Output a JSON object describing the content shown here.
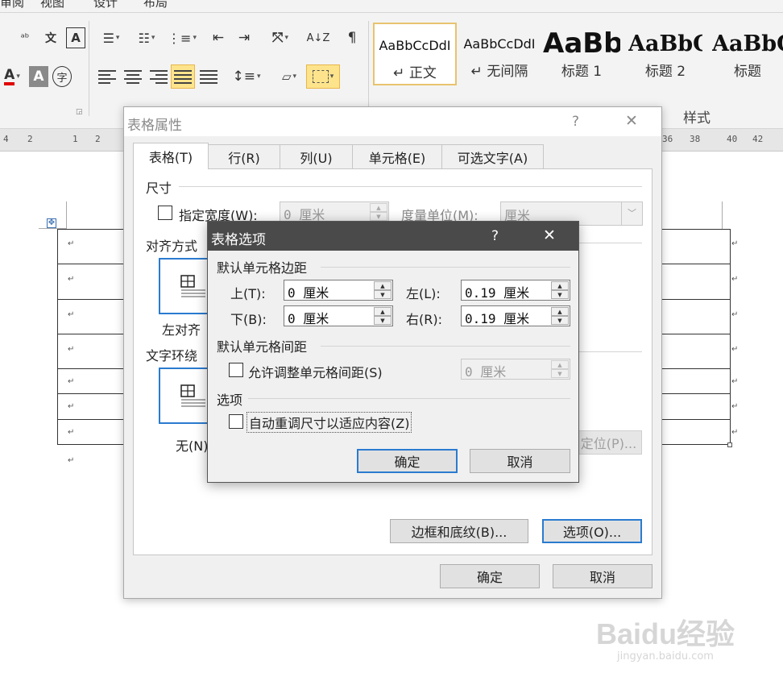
{
  "ribbon": {
    "tabs": [
      "审阅",
      "视图",
      "设计",
      "布局"
    ],
    "styles": [
      {
        "preview": "AaBbCcDdI",
        "name": "↵ 正文",
        "active": true
      },
      {
        "preview": "AaBbCcDdI",
        "name": "↵ 无间隔",
        "active": false
      },
      {
        "preview": "AaBb",
        "name": "标题 1",
        "active": false
      },
      {
        "preview": "AaBbC",
        "name": "标题 2",
        "active": false
      },
      {
        "preview": "AaBbC",
        "name": "标题",
        "active": false
      }
    ],
    "styles_group_label": "样式"
  },
  "ruler": {
    "left_numbers": [
      "4",
      "2",
      "1",
      "2"
    ],
    "right_numbers": [
      "36",
      "38",
      "40",
      "42"
    ]
  },
  "document": {
    "row_count": 7,
    "paragraph_mark": "↵"
  },
  "table_properties": {
    "title": "表格属性",
    "help": "?",
    "close": "✕",
    "tabs": [
      "表格(T)",
      "行(R)",
      "列(U)",
      "单元格(E)",
      "可选文字(A)"
    ],
    "size_section": "尺寸",
    "preferred_width_label": "指定宽度(W):",
    "preferred_width_value": "0 厘米",
    "measure_in_label": "度量单位(M):",
    "measure_in_value": "厘米",
    "alignment_section": "对齐方式",
    "align_left_label": "左对齐",
    "wrapping_section": "文字环绕",
    "wrap_none_label": "无(N)",
    "positioning_button_label": "定位(P)...",
    "borders_button": "边框和底纹(B)...",
    "options_button": "选项(O)...",
    "ok": "确定",
    "cancel": "取消"
  },
  "table_options": {
    "title": "表格选项",
    "help": "?",
    "close": "✕",
    "margins_section": "默认单元格边距",
    "top_label": "上(T):",
    "top_value": "0 厘米",
    "bottom_label": "下(B):",
    "bottom_value": "0 厘米",
    "left_label": "左(L):",
    "left_value": "0.19 厘米",
    "right_label": "右(R):",
    "right_value": "0.19 厘米",
    "spacing_section": "默认单元格间距",
    "allow_spacing_label": "允许调整单元格间距(S)",
    "allow_spacing_checked": false,
    "spacing_value": "0 厘米",
    "options_section": "选项",
    "autoresize_label": "自动重调尺寸以适应内容(Z)",
    "autoresize_checked": false,
    "ok": "确定",
    "cancel": "取消"
  },
  "watermark": {
    "brand": "Baidu经验",
    "url": "jingyan.baidu.com"
  }
}
